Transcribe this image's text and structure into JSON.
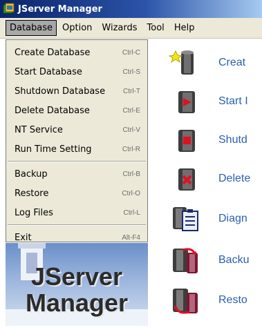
{
  "window": {
    "title": "JServer Manager"
  },
  "menubar": {
    "items": [
      {
        "label": "Database",
        "active": true
      },
      {
        "label": "Option"
      },
      {
        "label": "Wizards"
      },
      {
        "label": "Tool"
      },
      {
        "label": "Help"
      }
    ]
  },
  "dropdown": {
    "group1": [
      {
        "label": "Create Database",
        "shortcut": "Ctrl-C"
      },
      {
        "label": "Start Database",
        "shortcut": "Ctrl-S"
      },
      {
        "label": "Shutdown Database",
        "shortcut": "Ctrl-T"
      },
      {
        "label": "Delete Database",
        "shortcut": "Ctrl-E"
      },
      {
        "label": "NT Service",
        "shortcut": "Ctrl-V"
      },
      {
        "label": "Run Time Setting",
        "shortcut": "Ctrl-R"
      }
    ],
    "group2": [
      {
        "label": "Backup",
        "shortcut": "Ctrl-B"
      },
      {
        "label": "Restore",
        "shortcut": "Ctrl-O"
      },
      {
        "label": "Log Files",
        "shortcut": "Ctrl-L"
      }
    ],
    "group3": [
      {
        "label": "Exit",
        "shortcut": "Alt-F4"
      }
    ]
  },
  "tools": [
    {
      "label": "Creat",
      "icon": "create-database-icon"
    },
    {
      "label": "Start I",
      "icon": "start-database-icon"
    },
    {
      "label": "Shutd",
      "icon": "shutdown-database-icon"
    },
    {
      "label": "Delete",
      "icon": "delete-database-icon"
    },
    {
      "label": "Diagn",
      "icon": "diagnose-icon"
    },
    {
      "label": "Backu",
      "icon": "backup-icon"
    },
    {
      "label": "Resto",
      "icon": "restore-icon"
    }
  ],
  "logo": {
    "line1": "JServer",
    "line2": "Manager"
  },
  "colors": {
    "title_bar": "#0a246a",
    "menu_bg": "#ece9d8",
    "tool_label": "#2a5fb0",
    "accent_red": "#e01020"
  }
}
